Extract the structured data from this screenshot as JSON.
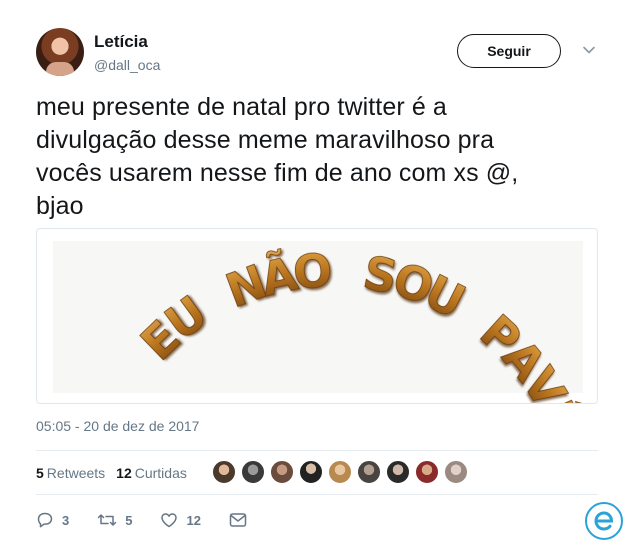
{
  "author": {
    "name": "Letícia",
    "handle": "@dall_oca"
  },
  "follow_button": "Seguir",
  "tweet": {
    "line1": "meu presente de natal pro twitter é a",
    "line2": "divulgação desse meme maravilhoso pra",
    "line3": "vocês usarem nesse fim de ano com xs @,",
    "line4": "bjao"
  },
  "image": {
    "text": "EU NÃO SOU PAVÊ",
    "letters": [
      "E",
      "U",
      " ",
      "N",
      "Ã",
      "O",
      " ",
      "S",
      "O",
      "U",
      " ",
      "P",
      "A",
      "V",
      "Ê"
    ]
  },
  "timestamp": "05:05 - 20 de dez de 2017",
  "stats": {
    "retweets_count": "5",
    "retweets_label": "Retweets",
    "likes_count": "12",
    "likes_label": "Curtidas"
  },
  "actions": {
    "replies": "3",
    "retweets": "5",
    "likes": "12"
  },
  "colors": {
    "text": "#14171a",
    "muted": "#657786",
    "border": "#e1e8ed",
    "meme_gold": "#b8741e",
    "watermark": "#2aa3d9"
  }
}
